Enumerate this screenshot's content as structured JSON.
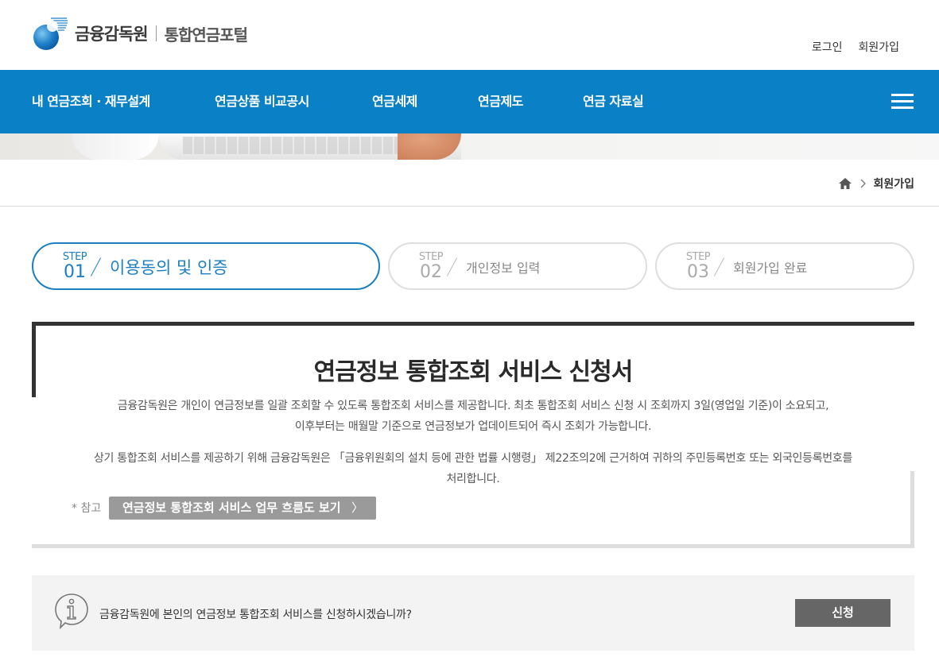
{
  "header": {
    "logo_org": "금융감독원",
    "logo_service": "통합연금포털",
    "util_links": [
      "로그인",
      "회원가입"
    ]
  },
  "nav": {
    "items": [
      "내 연금조회 · 재무설계",
      "연금상품 비교공시",
      "연금세제",
      "연금제도",
      "연금 자료실"
    ]
  },
  "breadcrumb": {
    "current": "회원가입"
  },
  "steps": [
    {
      "prefix": "STEP",
      "number": "01",
      "label": "이용동의 및 인증",
      "active": true
    },
    {
      "prefix": "STEP",
      "number": "02",
      "label": "개인정보 입력",
      "active": false
    },
    {
      "prefix": "STEP",
      "number": "03",
      "label": "회원가입 완료",
      "active": false
    }
  ],
  "application": {
    "title": "연금정보 통합조회 서비스 신청서",
    "para1_line1": "금융감독원은 개인이 연금정보를 일괄 조회할 수 있도록 통합조회 서비스를 제공합니다. 최초 통합조회 서비스 신청 시 조회까지 3일(영업일 기준)이 소요되고,",
    "para1_line2": "이후부터는 매월말 기준으로 연금정보가 업데이트되어 즉시 조회가 가능합니다.",
    "para2_line1": "상기 통합조회 서비스를 제공하기 위해 금융감독원은 「금융위원회의 설치 등에 관한 법률 시행령」 제22조의2에 근거하여 귀하의 주민등록번호 또는 외국인등록번호를",
    "para2_line2": "처리합니다.",
    "ref_label": "* 참고",
    "flow_button": "연금정보 통합조회 서비스 업무 흐름도 보기",
    "flow_button_arrow": "〉"
  },
  "confirm": {
    "question": "금융감독원에 본인의 연금정보 통합조회 서비스를 신청하시겠습니까?",
    "apply_button": "신청"
  },
  "colors": {
    "nav_bg": "#0a80c6",
    "step_active": "#1b7fc1",
    "apply_button_bg": "#666666",
    "flow_button_bg": "#9a9a9a"
  }
}
